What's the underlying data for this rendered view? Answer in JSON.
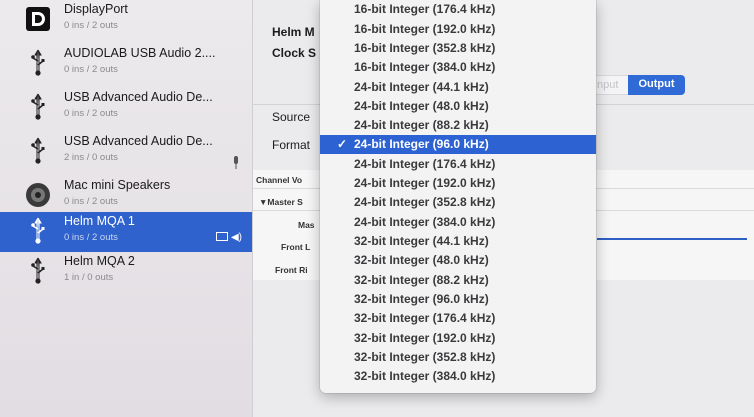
{
  "sidebar": {
    "devices": [
      {
        "name": "DisplayPort",
        "sub": "0 ins / 2 outs",
        "icon": "displayport-icon"
      },
      {
        "name": "AUDIOLAB USB Audio 2....",
        "sub": "0 ins / 2 outs",
        "icon": "usb-icon"
      },
      {
        "name": "USB Advanced Audio De...",
        "sub": "0 ins / 2 outs",
        "icon": "usb-icon"
      },
      {
        "name": "USB Advanced Audio De...",
        "sub": "2 ins / 0 outs",
        "icon": "usb-icon"
      },
      {
        "name": "Mac mini Speakers",
        "sub": "0 ins / 2 outs",
        "icon": "speaker-icon"
      },
      {
        "name": "Helm MQA 1",
        "sub": "0 ins / 2 outs",
        "icon": "usb-icon",
        "selected": true
      },
      {
        "name": "Helm MQA 2",
        "sub": "1 in / 0 outs",
        "icon": "usb-icon"
      }
    ]
  },
  "main": {
    "device_label": "Helm M",
    "clock_label": "Clock S",
    "input_tab": "Input",
    "output_tab": "Output",
    "source_label": "Source",
    "format_label": "Format",
    "channel_volume_header": "Channel Vo",
    "master_row": "▼Master S",
    "mas_row": "Mas",
    "front_left_row": "Front L",
    "front_right_row": "Front Ri"
  },
  "format_menu": {
    "selected_index": 8,
    "check": "✓",
    "items": [
      "16-bit Integer (176.4 kHz)",
      "16-bit Integer (192.0 kHz)",
      "16-bit Integer (352.8 kHz)",
      "16-bit Integer (384.0 kHz)",
      "24-bit Integer (44.1 kHz)",
      "24-bit Integer (48.0 kHz)",
      "24-bit Integer (88.2 kHz)",
      "24-bit Integer (96.0 kHz)",
      "24-bit Integer (176.4 kHz)",
      "24-bit Integer (192.0 kHz)",
      "24-bit Integer (352.8 kHz)",
      "24-bit Integer (384.0 kHz)",
      "32-bit Integer (44.1 kHz)",
      "32-bit Integer (48.0 kHz)",
      "32-bit Integer (88.2 kHz)",
      "32-bit Integer (96.0 kHz)",
      "32-bit Integer (176.4 kHz)",
      "32-bit Integer (192.0 kHz)",
      "32-bit Integer (352.8 kHz)",
      "32-bit Integer (384.0 kHz)"
    ]
  },
  "colors": {
    "selection": "#2f62cc",
    "menu_selection": "#2d62d3",
    "output_tab": "#2f6ad6"
  }
}
